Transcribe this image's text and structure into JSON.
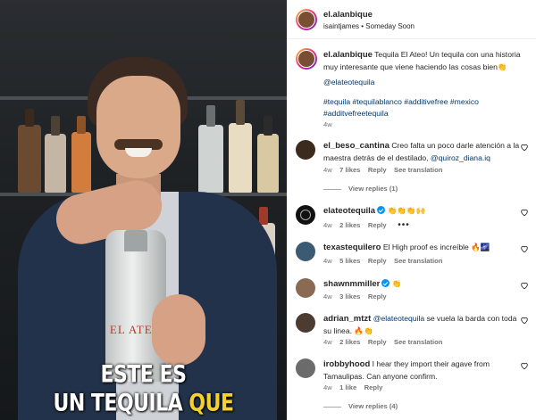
{
  "post": {
    "username": "el.alanbique",
    "audio_user": "isaintjames",
    "audio_track": "Someday Soon",
    "separator": "•",
    "caption_prefix": "Tequila El Ateo! Un tequila con una historia muy interesante que viene haciendo las cosas bien",
    "caption_emoji": "👏",
    "mention": "@elateotequila",
    "hashtags": "#tequila #tequilablanco #additivefree #mexico #additvefreetequila",
    "time": "4w"
  },
  "video": {
    "brand_label": "EL ATEO",
    "caption_line1": "ESTE ES",
    "caption_line2_white": "UN TEQUILA",
    "caption_line2_yellow": "QUE"
  },
  "comments": [
    {
      "username": "el_beso_cantina",
      "text": "Creo falta un poco darle atención a la maestra detrás de el destilado,",
      "mention": "@quiroz_diana.iq",
      "time": "4w",
      "likes": "7 likes",
      "reply": "Reply",
      "translate": "See translation",
      "view_replies": "View replies (1)",
      "avatar_color": "#3b2a1e"
    },
    {
      "username": "elateotequila",
      "verified": true,
      "text": "👏👏👏🙌",
      "time": "4w",
      "likes": "2 likes",
      "reply": "Reply",
      "more": "•••",
      "avatar_color": "#111111"
    },
    {
      "username": "texastequilero",
      "text": "El High proof es increíble 🔥🌌",
      "time": "4w",
      "likes": "5 likes",
      "reply": "Reply",
      "translate": "See translation",
      "avatar_color": "#3d5a73"
    },
    {
      "username": "shawnmmiller",
      "verified": true,
      "text": "👏",
      "time": "4w",
      "likes": "3 likes",
      "reply": "Reply",
      "avatar_color": "#8a6a52"
    },
    {
      "username": "adrian_mtzt",
      "mention": "@elateotequila",
      "text": "se vuela la barda con toda su linea. 🔥👏",
      "time": "4w",
      "likes": "2 likes",
      "reply": "Reply",
      "translate": "See translation",
      "avatar_color": "#4b3b30"
    },
    {
      "username": "irobbyhood",
      "text": "I hear they import their agave from Tamaulipas. Can anyone confirm.",
      "time": "4w",
      "likes": "1 like",
      "reply": "Reply",
      "view_replies": "View replies (4)",
      "avatar_color": "#6b6b6b"
    }
  ]
}
